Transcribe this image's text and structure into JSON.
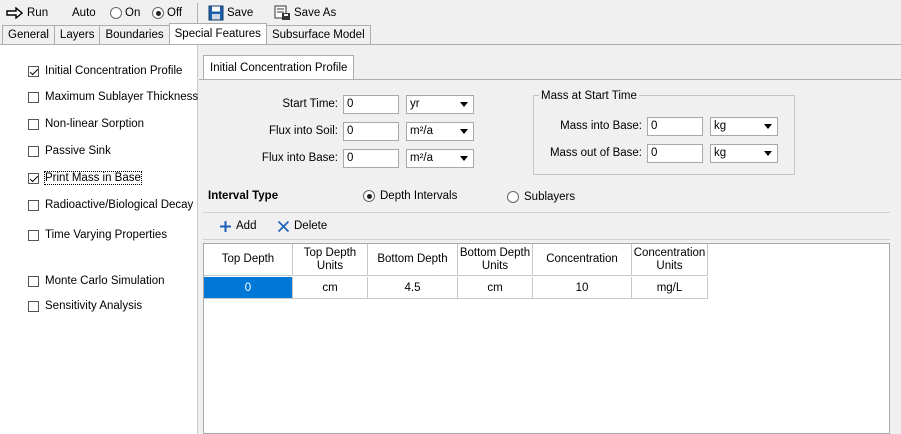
{
  "toolbar": {
    "run_label": "Run",
    "auto_label": "Auto",
    "on_label": "On",
    "off_label": "Off",
    "auto_selected": "Off",
    "save_label": "Save",
    "save_as_label": "Save As"
  },
  "tabs": [
    {
      "label": "General",
      "active": false
    },
    {
      "label": "Layers",
      "active": false
    },
    {
      "label": "Boundaries",
      "active": false
    },
    {
      "label": "Special Features",
      "active": true
    },
    {
      "label": "Subsurface Model",
      "active": false
    }
  ],
  "features": [
    {
      "label": "Initial Concentration Profile",
      "checked": true
    },
    {
      "label": "Maximum Sublayer Thickness",
      "checked": false
    },
    {
      "label": "Non-linear Sorption",
      "checked": false
    },
    {
      "label": "Passive Sink",
      "checked": false
    },
    {
      "label": "Print Mass in Base",
      "checked": true
    },
    {
      "label": "Radioactive/Biological Decay",
      "checked": false
    },
    {
      "label": "Time Varying Properties",
      "checked": false
    },
    {
      "label": "Monte Carlo Simulation",
      "checked": false
    },
    {
      "label": "Sensitivity Analysis",
      "checked": false
    }
  ],
  "subtab": {
    "label": "Initial Concentration Profile"
  },
  "form": {
    "start_time": {
      "label": "Start Time:",
      "value": "0",
      "unit": "yr"
    },
    "flux_soil": {
      "label": "Flux into Soil:",
      "value": "0",
      "unit": "m²/a"
    },
    "flux_base": {
      "label": "Flux into Base:",
      "value": "0",
      "unit": "m²/a"
    }
  },
  "mass_group": {
    "title": "Mass at Start Time",
    "into_base": {
      "label": "Mass into Base:",
      "value": "0",
      "unit": "kg"
    },
    "out_of_base": {
      "label": "Mass out of Base:",
      "value": "0",
      "unit": "kg"
    }
  },
  "interval": {
    "title": "Interval Type",
    "depth_label": "Depth Intervals",
    "sublayers_label": "Sublayers",
    "selected": "Depth Intervals"
  },
  "grid_toolbar": {
    "add_label": "Add",
    "delete_label": "Delete"
  },
  "table": {
    "columns": [
      "Top Depth",
      "Top Depth Units",
      "Bottom Depth",
      "Bottom Depth Units",
      "Concentration",
      "Concentration Units"
    ],
    "rows": [
      [
        "0",
        "cm",
        "4.5",
        "cm",
        "10",
        "mg/L"
      ]
    ]
  }
}
